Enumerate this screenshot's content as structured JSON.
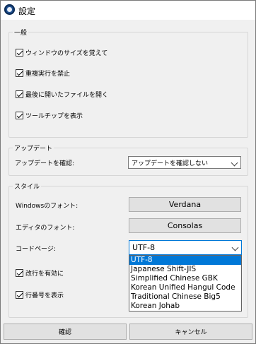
{
  "window": {
    "title": "設定"
  },
  "general": {
    "heading": "一般",
    "options": [
      {
        "label": "ウィンドウのサイズを覚えて",
        "checked": true
      },
      {
        "label": "重複実行を禁止",
        "checked": true
      },
      {
        "label": "最後に開いたファイルを開く",
        "checked": true
      },
      {
        "label": "ツールチップを表示",
        "checked": true
      }
    ]
  },
  "update": {
    "heading": "アップデート",
    "check_label": "アップデートを確認:",
    "check_value": "アップデートを確認しない"
  },
  "style": {
    "heading": "スタイル",
    "windows_font_label": "Windowsのフォント:",
    "windows_font_value": "Verdana",
    "editor_font_label": "エディタのフォント:",
    "editor_font_value": "Consolas",
    "codepage_label": "コードページ:",
    "codepage_value": "UTF-8",
    "codepage_options": [
      "UTF-8",
      "Japanese Shift-JIS",
      "Simplified Chinese GBK",
      "Korean Unified Hangul Code",
      "Traditional Chinese Big5",
      "Korean Johab"
    ],
    "wrap_label": "改行を有効に",
    "wrap_checked": true,
    "line_numbers_label": "行番号を表示",
    "line_numbers_checked": true
  },
  "buttons": {
    "ok": "確認",
    "cancel": "キャンセル"
  },
  "icons": {
    "app": "gear-icon",
    "combo": "chevron-down-icon"
  },
  "colors": {
    "accent": "#0078d7"
  }
}
